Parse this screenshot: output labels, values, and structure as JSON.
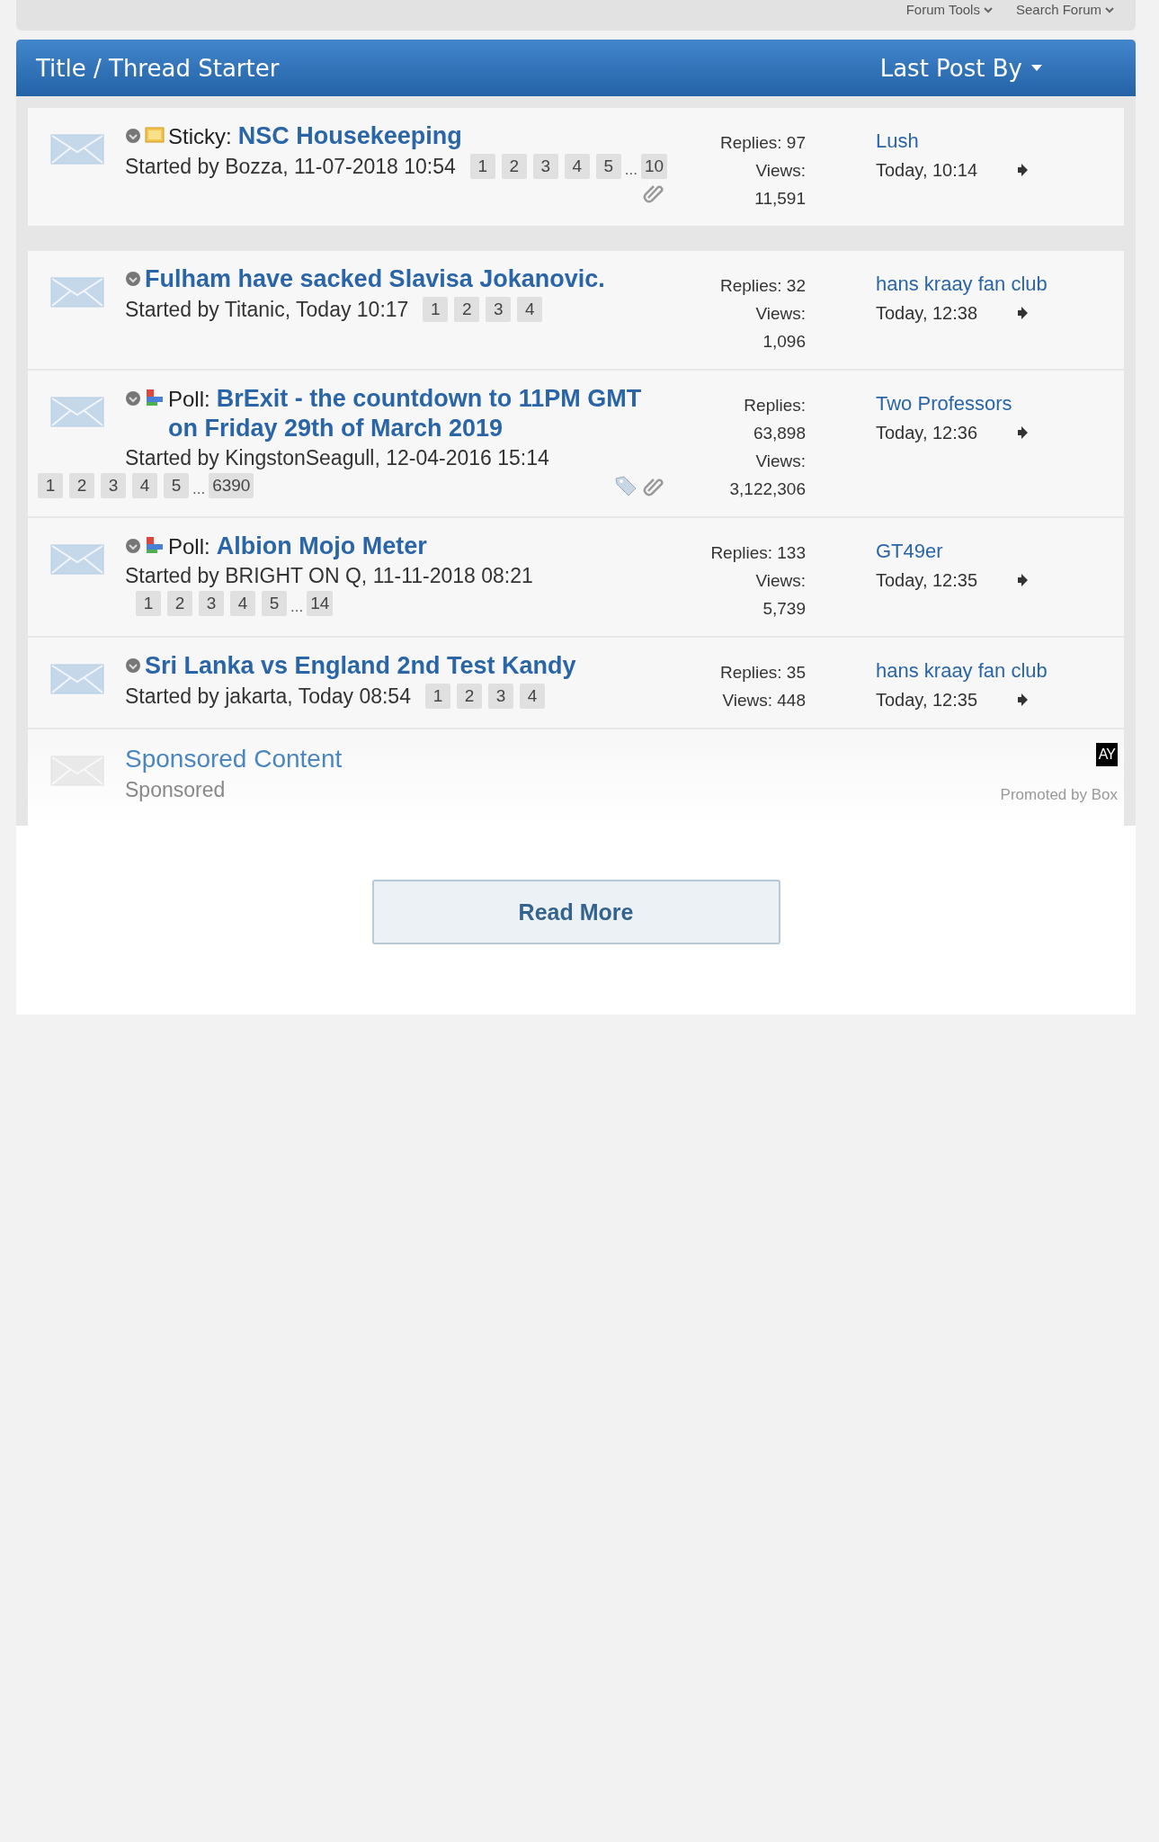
{
  "toolbar": {
    "links": [
      {
        "label": "Forum Tools"
      },
      {
        "label": "Search Forum"
      }
    ]
  },
  "header": {
    "title": "Title / Thread Starter",
    "last_post": "Last Post By"
  },
  "sticky_threads": [
    {
      "kind": "sticky",
      "prefix": "Sticky:",
      "title": "NSC Housekeeping",
      "starter": "Started by Bozza, 11-07-2018 10:54",
      "pager": {
        "kind": "inline",
        "pages": [
          {
            "label": "1",
            "kind": "page"
          },
          {
            "label": "2",
            "kind": "page"
          },
          {
            "label": "3",
            "kind": "page"
          },
          {
            "label": "4",
            "kind": "page"
          },
          {
            "label": "5",
            "kind": "page"
          },
          {
            "label": "...",
            "kind": "gap"
          },
          {
            "label": "10",
            "kind": "page"
          }
        ]
      },
      "tagged": false,
      "attachment": true,
      "stats": [
        "Replies: 97",
        "Views:",
        "11,591"
      ],
      "last_by": "Lush",
      "last_time": "Today, 10:14"
    }
  ],
  "threads": [
    {
      "kind": "normal",
      "title": "Fulham have sacked Slavisa Jokanovic.",
      "starter": "Started by Titanic, Today 10:17",
      "pager": {
        "kind": "inline",
        "pages": [
          {
            "label": "1",
            "kind": "page"
          },
          {
            "label": "2",
            "kind": "page"
          },
          {
            "label": "3",
            "kind": "page"
          },
          {
            "label": "4",
            "kind": "page"
          }
        ]
      },
      "tagged": false,
      "attachment": false,
      "stats": [
        "Replies: 32",
        "Views:",
        "1,096"
      ],
      "last_by": "hans kraay fan club",
      "last_time": "Today, 12:38"
    },
    {
      "kind": "poll",
      "prefix": "Poll:",
      "title": "BrExit - the countdown to 11PM GMT on Friday 29th of March 2019",
      "starter": "Started by KingstonSeagull, 12-04-2016 15:14",
      "pager": {
        "kind": "wide",
        "pages": [
          {
            "label": "1",
            "kind": "page"
          },
          {
            "label": "2",
            "kind": "page"
          },
          {
            "label": "3",
            "kind": "page"
          },
          {
            "label": "4",
            "kind": "page"
          },
          {
            "label": "5",
            "kind": "page"
          },
          {
            "label": "...",
            "kind": "gap"
          },
          {
            "label": "6390",
            "kind": "page"
          }
        ]
      },
      "tagged": true,
      "attachment": true,
      "stats": [
        "Replies:",
        "63,898",
        "Views:",
        "3,122,306"
      ],
      "last_by": "Two Professors",
      "last_time": "Today, 12:36"
    },
    {
      "kind": "poll",
      "prefix": "Poll:",
      "title": "Albion Mojo Meter",
      "starter": "Started by BRIGHT ON Q, 11-11-2018 08:21",
      "pager": {
        "kind": "below",
        "pages": [
          {
            "label": "1",
            "kind": "page"
          },
          {
            "label": "2",
            "kind": "page"
          },
          {
            "label": "3",
            "kind": "page"
          },
          {
            "label": "4",
            "kind": "page"
          },
          {
            "label": "5",
            "kind": "page"
          },
          {
            "label": "...",
            "kind": "gap"
          },
          {
            "label": "14",
            "kind": "page"
          }
        ]
      },
      "tagged": false,
      "attachment": false,
      "stats": [
        "Replies: 133",
        "Views:",
        "5,739"
      ],
      "last_by": "GT49er",
      "last_time": "Today, 12:35"
    },
    {
      "kind": "normal",
      "title": "Sri Lanka vs England 2nd Test Kandy",
      "starter": "Started by jakarta, Today 08:54",
      "pager": {
        "kind": "inline",
        "pages": [
          {
            "label": "1",
            "kind": "page"
          },
          {
            "label": "2",
            "kind": "page"
          },
          {
            "label": "3",
            "kind": "page"
          },
          {
            "label": "4",
            "kind": "page"
          }
        ]
      },
      "tagged": false,
      "attachment": false,
      "stats": [
        "Replies: 35",
        "Views: 448"
      ],
      "last_by": "hans kraay fan club",
      "last_time": "Today, 12:35"
    }
  ],
  "sponsored": {
    "title": "Sponsored Content",
    "label": "Sponsored",
    "badge": "AY",
    "promoted": "Promoted by Box"
  },
  "read_more": "Read More"
}
